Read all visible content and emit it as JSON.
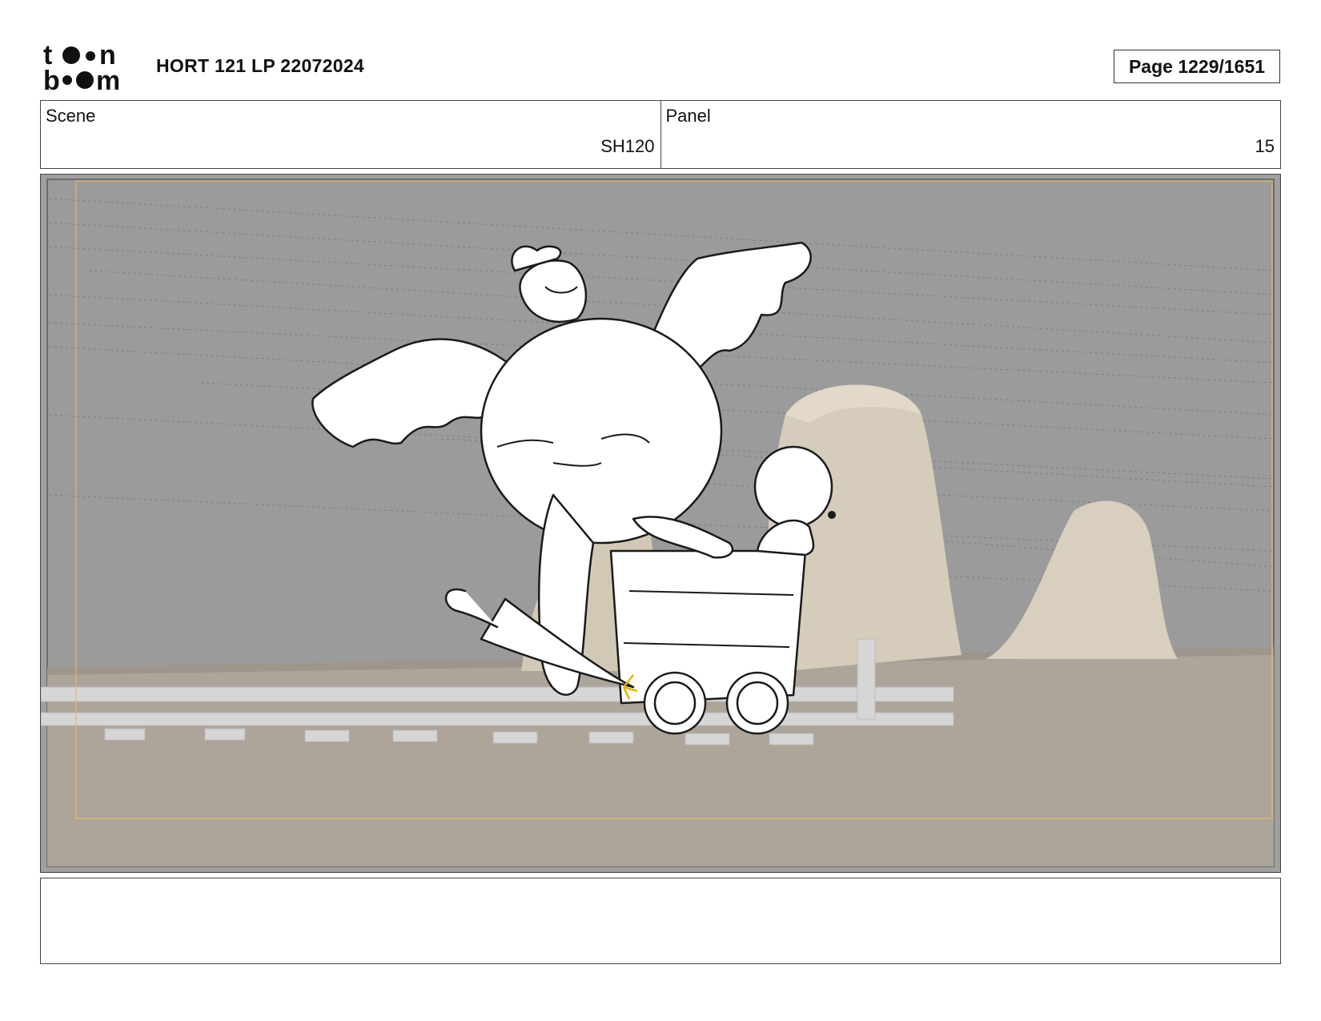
{
  "header": {
    "logo_text": "toon boom",
    "title": "HORT 121 LP 22072024",
    "page_indicator": "Page 1229/1651"
  },
  "info": {
    "scene_label": "Scene",
    "scene_value": "SH120",
    "panel_label": "Panel",
    "panel_value": "15"
  },
  "panel_image": {
    "icon": "storyboard-panel-drawing"
  },
  "notes": {
    "text": ""
  }
}
